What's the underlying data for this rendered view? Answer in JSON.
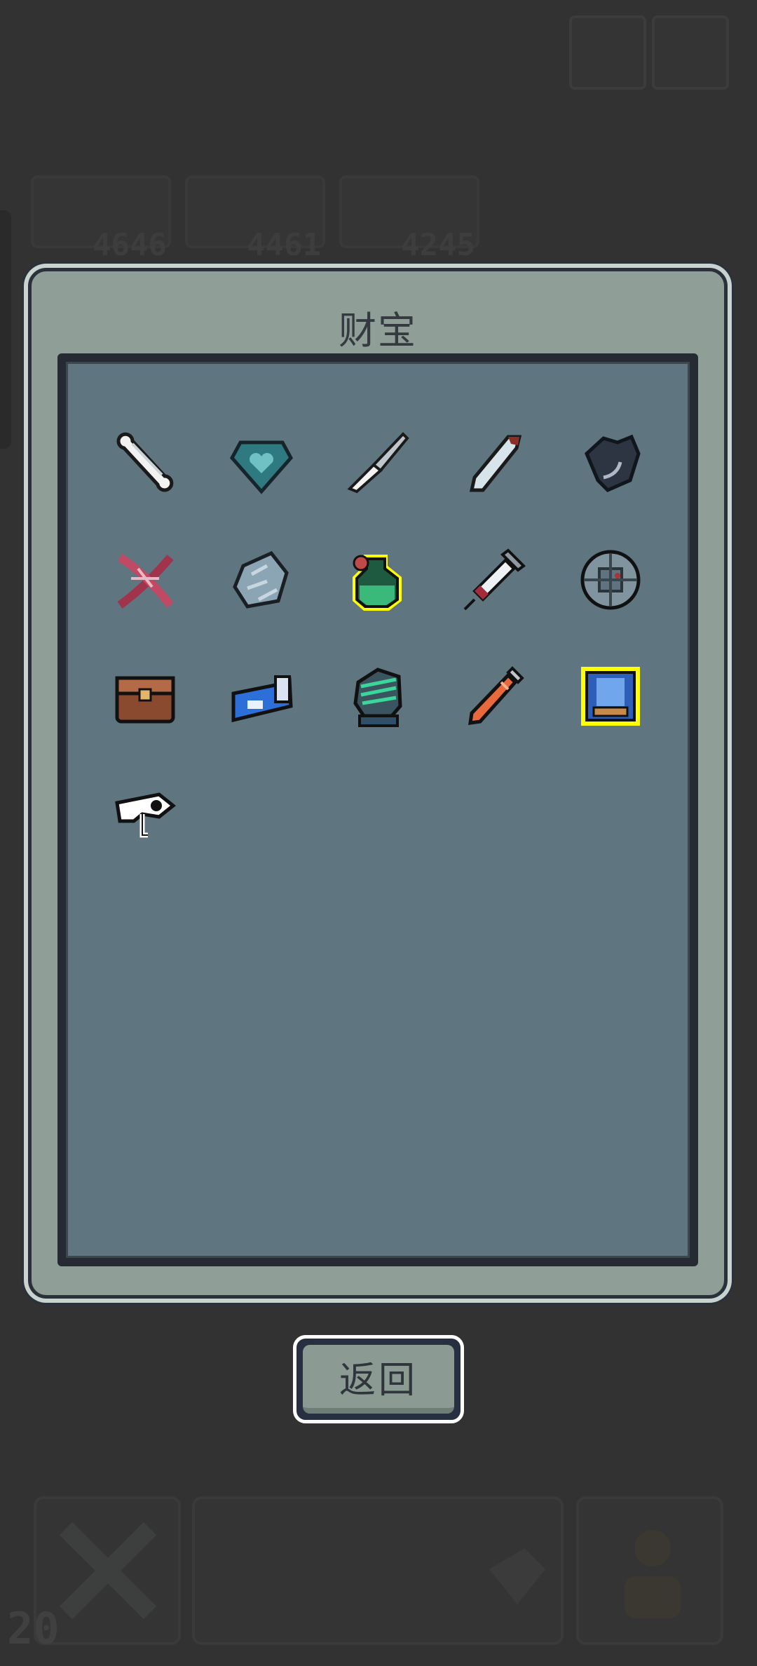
{
  "dialog": {
    "title": "财宝",
    "back_label": "返回"
  },
  "background": {
    "scores": [
      "4646",
      "4461",
      "4245"
    ],
    "level": "20"
  },
  "items": [
    {
      "name": "bone-icon",
      "highlighted": false
    },
    {
      "name": "heart-gem-icon",
      "highlighted": false
    },
    {
      "name": "scalpel-icon",
      "highlighted": false
    },
    {
      "name": "feather-blade-icon",
      "highlighted": false
    },
    {
      "name": "dark-claw-icon",
      "highlighted": false
    },
    {
      "name": "dna-helix-icon",
      "highlighted": false
    },
    {
      "name": "ore-rock-icon",
      "highlighted": false
    },
    {
      "name": "green-potion-icon",
      "highlighted": true
    },
    {
      "name": "syringe-icon",
      "highlighted": false
    },
    {
      "name": "round-shield-icon",
      "highlighted": false
    },
    {
      "name": "treasure-chest-icon",
      "highlighted": false
    },
    {
      "name": "blue-capsule-icon",
      "highlighted": false
    },
    {
      "name": "green-gauntlet-icon",
      "highlighted": false
    },
    {
      "name": "orange-dagger-icon",
      "highlighted": false
    },
    {
      "name": "blue-armor-icon",
      "highlighted": true
    },
    {
      "name": "eye-key-icon",
      "highlighted": false
    }
  ],
  "colors": {
    "highlight": "#ffff00",
    "panel": "#5f7680",
    "frame": "#8f9e97"
  }
}
